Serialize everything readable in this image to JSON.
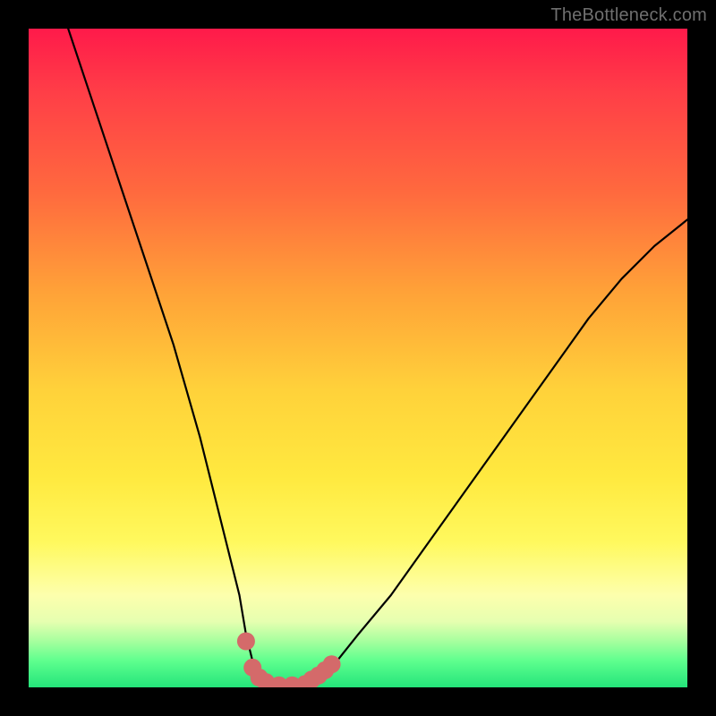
{
  "watermark": "TheBottleneck.com",
  "colors": {
    "background": "#000000",
    "gradient_top": "#ff1a4a",
    "gradient_bottom": "#24e47a",
    "curve": "#000000",
    "marker": "#d46a6a"
  },
  "chart_data": {
    "type": "line",
    "title": "",
    "xlabel": "",
    "ylabel": "",
    "xlim": [
      0,
      100
    ],
    "ylim": [
      0,
      100
    ],
    "series": [
      {
        "name": "bottleneck-curve",
        "x": [
          6,
          10,
          14,
          18,
          22,
          26,
          28,
          30,
          32,
          33,
          34,
          36,
          38,
          40,
          42,
          44,
          46,
          50,
          55,
          60,
          65,
          70,
          75,
          80,
          85,
          90,
          95,
          100
        ],
        "values": [
          100,
          88,
          76,
          64,
          52,
          38,
          30,
          22,
          14,
          8,
          4,
          1,
          0,
          0,
          0,
          1,
          3,
          8,
          14,
          21,
          28,
          35,
          42,
          49,
          56,
          62,
          67,
          71
        ]
      }
    ],
    "markers": {
      "name": "highlight-dots",
      "x": [
        33,
        34,
        35,
        36,
        38,
        40,
        42,
        43,
        44,
        45,
        46
      ],
      "values": [
        7,
        3,
        1.5,
        0.8,
        0.3,
        0.3,
        0.5,
        1.2,
        1.8,
        2.6,
        3.5
      ],
      "radius_px": 10
    }
  }
}
